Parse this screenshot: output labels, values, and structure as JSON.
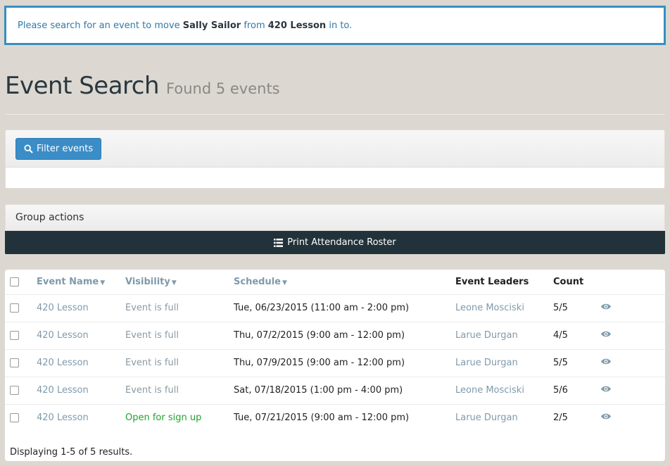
{
  "alert": {
    "prefix": "Please search for an event to move",
    "person": "Sally Sailor",
    "middle": "from",
    "event": "420 Lesson",
    "suffix": "in to."
  },
  "header": {
    "title": "Event Search",
    "subtitle": "Found 5 events"
  },
  "filter": {
    "button_label": "Filter events",
    "icon": "search-icon"
  },
  "group_actions": {
    "label": "Group actions",
    "print_label": "Print Attendance Roster",
    "icon": "list-icon"
  },
  "table": {
    "columns": {
      "event_name": "Event Name",
      "visibility": "Visibility",
      "schedule": "Schedule",
      "leaders": "Event Leaders",
      "count": "Count"
    },
    "rows": [
      {
        "name": "420 Lesson",
        "visibility": "Event is full",
        "schedule": "Tue, 06/23/2015 (11:00 am - 2:00 pm)",
        "leader": "Leone Mosciski",
        "count": "5/5"
      },
      {
        "name": "420 Lesson",
        "visibility": "Event is full",
        "schedule": "Thu, 07/2/2015 (9:00 am - 12:00 pm)",
        "leader": "Larue Durgan",
        "count": "4/5"
      },
      {
        "name": "420 Lesson",
        "visibility": "Event is full",
        "schedule": "Thu, 07/9/2015 (9:00 am - 12:00 pm)",
        "leader": "Larue Durgan",
        "count": "5/5"
      },
      {
        "name": "420 Lesson",
        "visibility": "Event is full",
        "schedule": "Sat, 07/18/2015 (1:00 pm - 4:00 pm)",
        "leader": "Leone Mosciski",
        "count": "5/6"
      },
      {
        "name": "420 Lesson",
        "visibility": "Open for sign up",
        "schedule": "Tue, 07/21/2015 (9:00 am - 12:00 pm)",
        "leader": "Larue Durgan",
        "count": "2/5"
      }
    ],
    "summary": "Displaying 1-5 of 5 results."
  },
  "colors": {
    "accent": "#3b8dc7",
    "dark_bar": "#22323a",
    "open_status": "#1fa32e"
  }
}
